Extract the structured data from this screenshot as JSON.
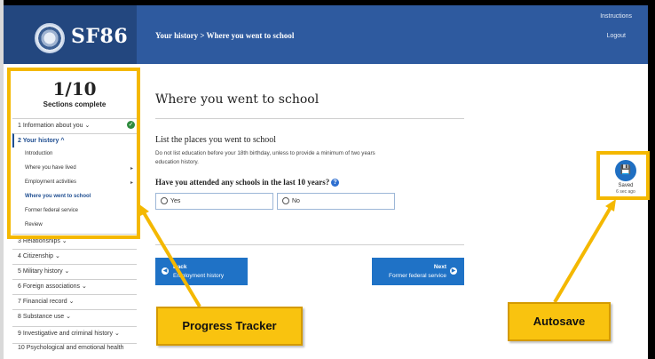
{
  "header": {
    "app_title": "SF86",
    "breadcrumb": "Your history > Where you went to school",
    "instructions_link": "Instructions",
    "logout_link": "Logout"
  },
  "progress": {
    "count": "1/10",
    "label": "Sections complete"
  },
  "sidebar": {
    "sections": [
      {
        "label": "1 Information about you ⌄",
        "complete": true
      },
      {
        "label": "2 Your history ^",
        "active": true
      },
      {
        "label": "3 Relationships ⌄"
      },
      {
        "label": "4 Citizenship ⌄"
      },
      {
        "label": "5 Military history ⌄"
      },
      {
        "label": "6 Foreign associations ⌄"
      },
      {
        "label": "7 Financial record ⌄"
      },
      {
        "label": "8 Substance use ⌄"
      },
      {
        "label": "9 Investigative and criminal history ⌄"
      },
      {
        "label": "10 Psychological and emotional health"
      }
    ],
    "subitems": [
      {
        "label": "Introduction"
      },
      {
        "label": "Where you have lived",
        "expandable": true
      },
      {
        "label": "Employment activities",
        "expandable": true
      },
      {
        "label": "Where you went to school",
        "current": true
      },
      {
        "label": "Former federal service"
      },
      {
        "label": "Review"
      }
    ]
  },
  "main": {
    "page_title": "Where you went to school",
    "section_heading": "List the places you went to school",
    "help_text": "Do not list education before your 18th birthday, unless to provide a minimum of two years education history.",
    "question": "Have you attended any schools in the last 10 years?",
    "options": [
      {
        "label": "Yes"
      },
      {
        "label": "No"
      }
    ],
    "back_button": {
      "line1": "Back",
      "line2": "Employment history"
    },
    "next_button": {
      "line1": "Next",
      "line2": "Former federal service"
    }
  },
  "autosave": {
    "label": "Saved",
    "time": "6 sec ago"
  },
  "annotations": {
    "tracker": "Progress Tracker",
    "autosave": "Autosave"
  },
  "colors": {
    "header": "#2e5a9f",
    "brand_bg": "#23477f",
    "button": "#1f72c6",
    "highlight": "#f4b800",
    "callout": "#f9c30f",
    "complete_check": "#2e8b3e"
  }
}
